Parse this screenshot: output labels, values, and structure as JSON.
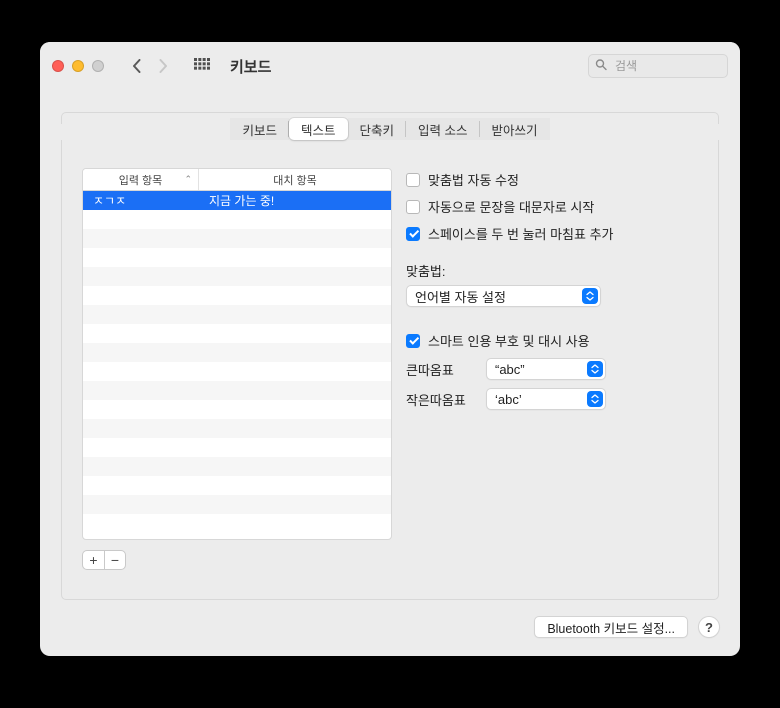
{
  "window": {
    "title": "키보드",
    "search_placeholder": "검색"
  },
  "tabs": [
    {
      "label": "키보드"
    },
    {
      "label": "텍스트",
      "active": true
    },
    {
      "label": "단축키"
    },
    {
      "label": "입력 소스"
    },
    {
      "label": "받아쓰기"
    }
  ],
  "table": {
    "headers": {
      "input": "입력 항목",
      "replace": "대치 항목"
    },
    "rows": [
      {
        "input": "ㅈㄱㅈ",
        "replace": "지금 가는 중!",
        "selected": true
      }
    ]
  },
  "options": {
    "autocorrect": {
      "label": "맞춤법 자동 수정",
      "checked": false
    },
    "capitalize": {
      "label": "자동으로 문장을 대문자로 시작",
      "checked": false
    },
    "double_space": {
      "label": "스페이스를 두 번 눌러 마침표 추가",
      "checked": true
    }
  },
  "spelling": {
    "label": "맞춤법:",
    "value": "언어별 자동 설정"
  },
  "smart_quotes": {
    "label": "스마트 인용 부호 및 대시 사용",
    "checked": true,
    "double_label": "큰따옴표",
    "double_value": "“abc”",
    "single_label": "작은따옴표",
    "single_value": "‘abc’"
  },
  "footer": {
    "bluetooth": "Bluetooth 키보드 설정..."
  }
}
